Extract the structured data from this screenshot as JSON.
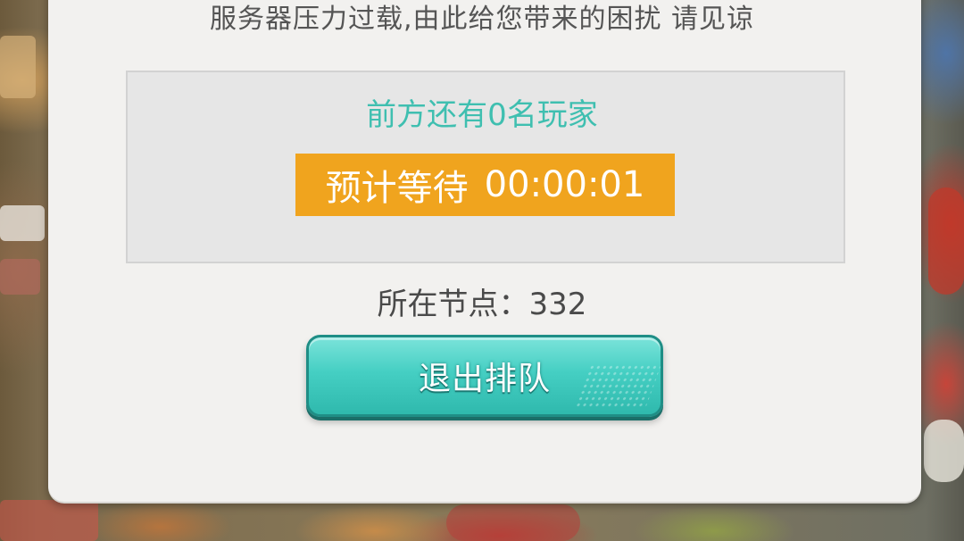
{
  "notice": {
    "text": "服务器压力过载,由此给您带来的困扰 请见谅"
  },
  "queue": {
    "ahead_text": "前方还有0名玩家",
    "wait_label": "预计等待",
    "wait_time": "00:00:01"
  },
  "node": {
    "text": "所在节点：332"
  },
  "exit_button": {
    "label": "退出排队"
  },
  "colors": {
    "panel_bg": "#f2f1ef",
    "accent_teal": "#3fbfb0",
    "wait_bar": "#f0a41e",
    "button": "#45cfc3"
  }
}
